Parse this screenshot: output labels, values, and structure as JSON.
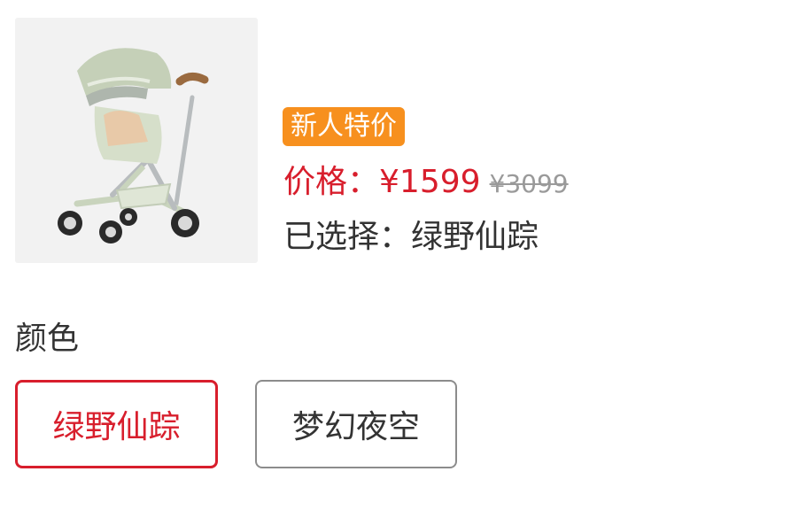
{
  "product": {
    "image_alt": "stroller product image",
    "badge": "新人特价",
    "price_label": "价格：",
    "price": "¥1599",
    "original_price": "¥3099",
    "selected_label": "已选择：",
    "selected_value": "绿野仙踪"
  },
  "colors": {
    "heading": "颜色",
    "options": [
      {
        "label": "绿野仙踪",
        "selected": true
      },
      {
        "label": "梦幻夜空",
        "selected": false
      }
    ]
  },
  "theme": {
    "accent": "#d81e2c",
    "badge_bg": "#f7901e",
    "thumb_bg": "#f2f2f2",
    "unselected_border": "#8c8c8c"
  }
}
